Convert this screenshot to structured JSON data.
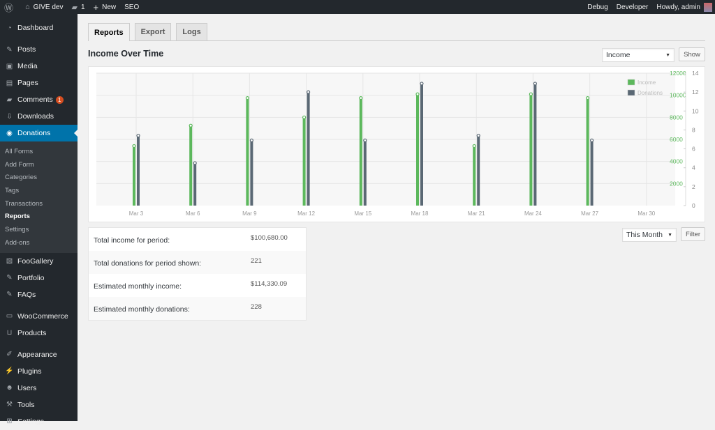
{
  "adminbar": {
    "wp_logo": "wordpress-logo",
    "site_name": "GIVE dev",
    "comments_count": "1",
    "new_label": "New",
    "seo_label": "SEO",
    "debug_label": "Debug",
    "developer_label": "Developer",
    "howdy_label": "Howdy, admin"
  },
  "sidebar": {
    "items": [
      {
        "label": "Dashboard",
        "icon": "dashboard-icon"
      },
      {
        "label": "Posts",
        "icon": "pin-icon"
      },
      {
        "label": "Media",
        "icon": "media-icon"
      },
      {
        "label": "Pages",
        "icon": "pages-icon"
      },
      {
        "label": "Comments",
        "icon": "comment-icon",
        "badge": "1"
      },
      {
        "label": "Downloads",
        "icon": "download-icon"
      },
      {
        "label": "Donations",
        "icon": "give-icon",
        "active": true
      }
    ],
    "submenu": [
      "All Forms",
      "Add Form",
      "Categories",
      "Tags",
      "Transactions",
      "Reports",
      "Settings",
      "Add-ons"
    ],
    "submenu_current": "Reports",
    "items2": [
      {
        "label": "FooGallery",
        "icon": "gallery-icon"
      },
      {
        "label": "Portfolio",
        "icon": "pin-icon"
      },
      {
        "label": "FAQs",
        "icon": "pin-icon"
      }
    ],
    "items3": [
      {
        "label": "WooCommerce",
        "icon": "woo-icon"
      },
      {
        "label": "Products",
        "icon": "cart-icon"
      }
    ],
    "items4": [
      {
        "label": "Appearance",
        "icon": "brush-icon"
      },
      {
        "label": "Plugins",
        "icon": "plug-icon"
      },
      {
        "label": "Users",
        "icon": "user-icon"
      },
      {
        "label": "Tools",
        "icon": "wrench-icon"
      },
      {
        "label": "Settings",
        "icon": "settings-icon"
      }
    ]
  },
  "tabs": [
    "Reports",
    "Export",
    "Logs"
  ],
  "active_tab": "Reports",
  "page_title": "Income Over Time",
  "view_select": {
    "value": "Income"
  },
  "show_button": "Show",
  "range_select": {
    "value": "This Month"
  },
  "filter_button": "Filter",
  "colors": {
    "income": "#5cb85c",
    "donations": "#5a6874",
    "accent": "#0073aa"
  },
  "chart_data": {
    "type": "bar",
    "title": "Income Over Time",
    "categories": [
      "Mar 3",
      "Mar 6",
      "Mar 9",
      "Mar 12",
      "Mar 15",
      "Mar 18",
      "Mar 21",
      "Mar 24",
      "Mar 27",
      "Mar 30"
    ],
    "series": [
      {
        "name": "Income",
        "axis": "left",
        "values": [
          5400,
          7250,
          9750,
          8000,
          9750,
          10100,
          5400,
          10100,
          9750,
          null
        ]
      },
      {
        "name": "Donations",
        "axis": "right",
        "values": [
          7.4,
          4.5,
          6.9,
          12,
          6.9,
          12.9,
          7.4,
          12.9,
          6.9,
          null
        ]
      }
    ],
    "y_left": {
      "ticks": [
        "2000",
        "4000",
        "6000",
        "8000",
        "10000",
        "12000"
      ],
      "range": [
        0,
        12000
      ]
    },
    "y_right": {
      "ticks": [
        "0",
        "2",
        "4",
        "6",
        "8",
        "10",
        "12",
        "14"
      ],
      "range": [
        0,
        14
      ]
    },
    "legend": [
      "Income",
      "Donations"
    ],
    "legend_position": "top-right",
    "grid": true
  },
  "stats": [
    {
      "label": "Total income for period:",
      "value": "$100,680.00"
    },
    {
      "label": "Total donations for period shown:",
      "value": "221"
    },
    {
      "label": "Estimated monthly income:",
      "value": "$114,330.09"
    },
    {
      "label": "Estimated monthly donations:",
      "value": "228"
    }
  ]
}
